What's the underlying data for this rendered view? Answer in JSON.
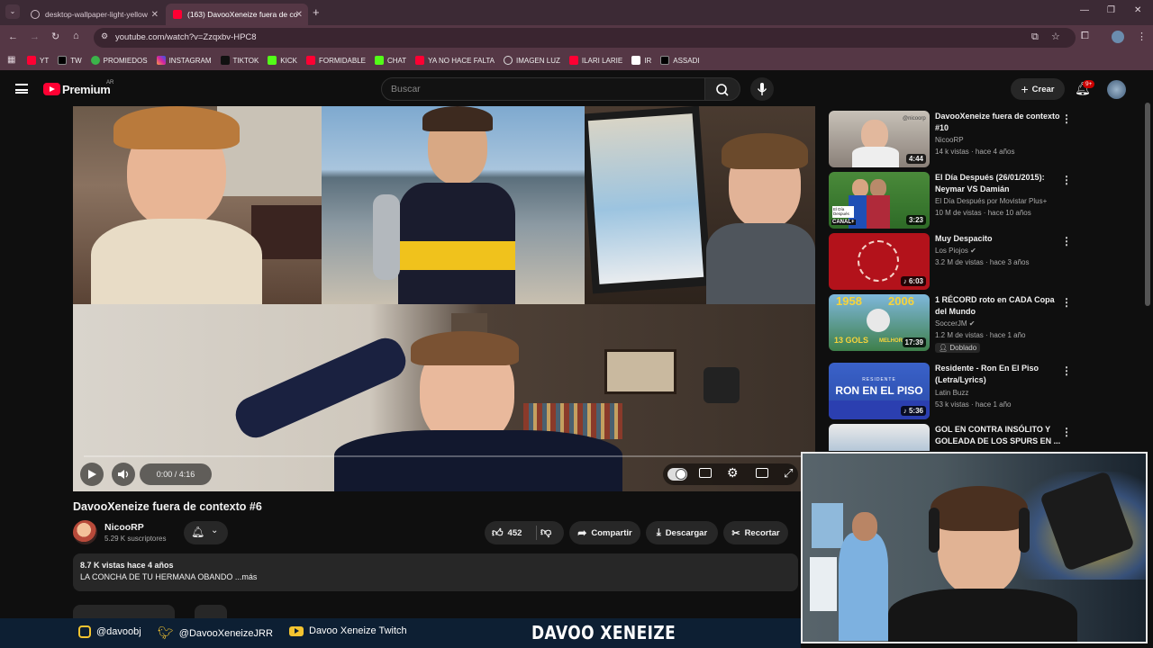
{
  "browser": {
    "tabs": [
      {
        "title": "desktop-wallpaper-light-yellow",
        "active": false
      },
      {
        "title": "(163) DavooXeneize fuera de co",
        "active": true
      }
    ],
    "url": "youtube.com/watch?v=Zzqxbv-HPC8",
    "bookmarks": [
      "YT",
      "TW",
      "PROMIEDOS",
      "INSTAGRAM",
      "TIKTOK",
      "KICK",
      "FORMIDABLE",
      "CHAT",
      "YA NO HACE FALTA",
      "IMAGEN LUZ",
      "ILARI LARIE",
      "IR",
      "ASSADI"
    ]
  },
  "header": {
    "logo_text": "Premium",
    "region": "AR",
    "search_placeholder": "Buscar",
    "create_label": "Crear",
    "notif_badge": "9+"
  },
  "player": {
    "time": "0:00 / 4:16"
  },
  "video": {
    "title": "DavooXeneize fuera de contexto #6",
    "channel": "NicooRP",
    "subscribers": "5.29 K suscriptores",
    "likes": "452",
    "share_label": "Compartir",
    "download_label": "Descargar",
    "clip_label": "Recortar",
    "views_line": "8.7 K vistas  hace 4 años",
    "description": "LA CONCHA DE TU HERMANA OBANDO ...más"
  },
  "recommendations": [
    {
      "title": "DavooXeneize fuera de contexto #10",
      "channel": "NicooRP",
      "meta": "14 k vistas · hace 4 años",
      "duration": "4:44",
      "verified": false
    },
    {
      "title": "El Día Después (26/01/2015): Neymar VS Damián",
      "channel": "El Día Después por Movistar Plus+",
      "meta": "10 M de vistas · hace 10 años",
      "duration": "3:23",
      "verified": false
    },
    {
      "title": "Muy Despacito",
      "channel": "Los Piojos",
      "meta": "3.2 M de vistas · hace 3 años",
      "duration": "6:03",
      "verified": true
    },
    {
      "title": "1 RÉCORD roto en CADA Copa del Mundo",
      "channel": "SoccerJM",
      "meta": "1.2 M de vistas · hace 1 año",
      "duration": "17:39",
      "verified": true,
      "badge": "Doblado"
    },
    {
      "title": "Residente - Ron En El Piso (Letra/Lyrics)",
      "channel": "Latin Buzz",
      "meta": "53 k vistas · hace 1 año",
      "duration": "5:36",
      "verified": false
    },
    {
      "title": "GOL EN CONTRA INSÓLITO Y GOLEADA DE LOS SPURS EN ...",
      "channel": "",
      "meta": "",
      "duration": "",
      "verified": false
    }
  ],
  "thumb_texts": {
    "t1": "@nicoorp",
    "t2a": "El Día Después",
    "t2b": "CANAL+",
    "t4a": "1958",
    "t4b": "2006",
    "t4c": "13 GOLS",
    "t4d": "MELHOR",
    "t5a": "RESIDENTE",
    "t5b": "RON EN EL PISO"
  },
  "banner": {
    "instagram": "@davoobj",
    "twitter": "@DavooXeneizeJRR",
    "twitch": "Davoo Xeneize Twitch",
    "brand": "DAVOO XENEIZE"
  },
  "colors": {
    "accent": "#ff0033",
    "bg": "#0f0f0f",
    "chrome": "#553745"
  }
}
